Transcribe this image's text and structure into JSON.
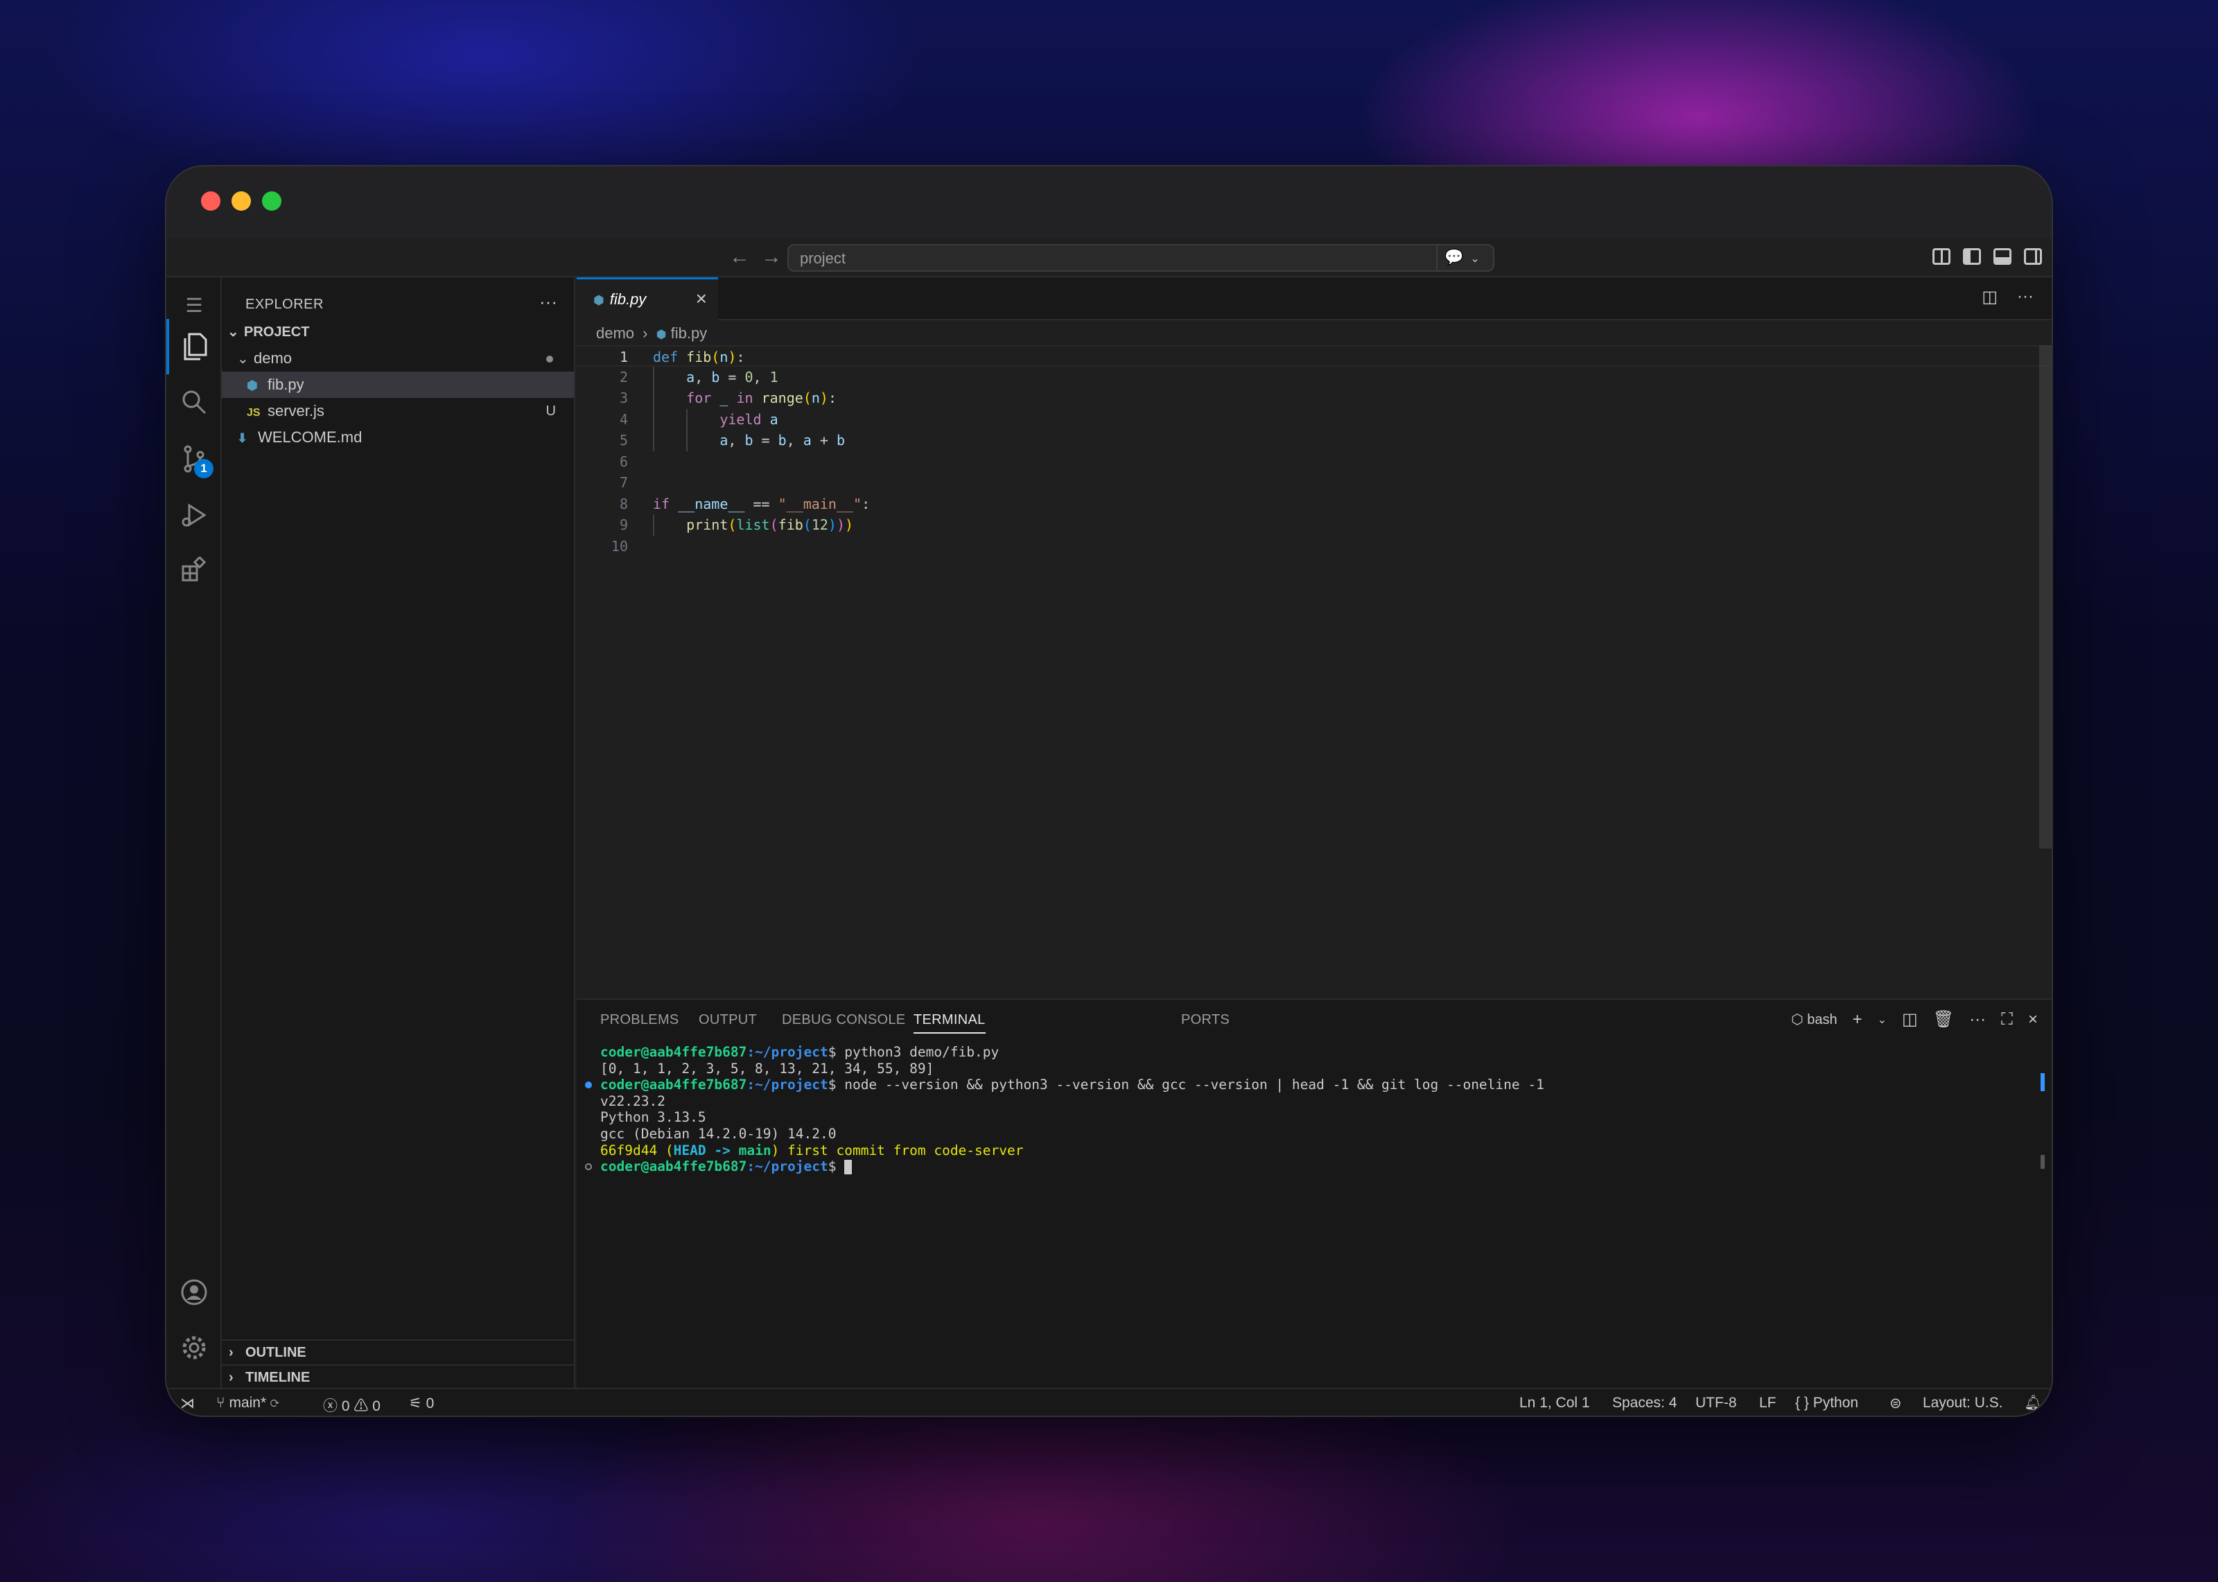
{
  "titlebar": {
    "search_text": "project"
  },
  "activity": {
    "scm_badge": "1"
  },
  "sidebar": {
    "title": "EXPLORER",
    "root": "PROJECT",
    "tree": [
      {
        "label": "demo",
        "kind": "folder"
      },
      {
        "label": "fib.py",
        "kind": "file",
        "icon": "python-icon",
        "selected": true
      },
      {
        "label": "server.js",
        "kind": "file",
        "icon": "js-icon",
        "status": "U"
      },
      {
        "label": "WELCOME.md",
        "kind": "file",
        "icon": "markdown-icon"
      }
    ],
    "js_icon_text": "JS",
    "sections": [
      "OUTLINE",
      "TIMELINE"
    ]
  },
  "editor": {
    "tab_label": "fib.py",
    "breadcrumb": [
      "demo",
      "fib.py"
    ],
    "line_numbers": [
      "1",
      "2",
      "3",
      "4",
      "5",
      "6",
      "7",
      "8",
      "9",
      "10"
    ]
  },
  "panel": {
    "tabs": [
      "PROBLEMS",
      "OUTPUT",
      "DEBUG CONSOLE",
      "TERMINAL",
      "PORTS"
    ],
    "active_tab": "TERMINAL",
    "shell_label": "bash",
    "terminal": {
      "prompt_user": "coder@aab4ffe7b687",
      "prompt_path": ":~/project",
      "cmd1": "$ python3 demo/fib.py",
      "out1": "[0, 1, 1, 2, 3, 5, 8, 13, 21, 34, 55, 89]",
      "cmd2": "$ node --version && python3 --version && gcc --version | head -1 && git log --oneline -1",
      "out2": "v22.23.2",
      "out3": "Python 3.13.5",
      "out4": "gcc (Debian 14.2.0-19) 14.2.0",
      "git_hash": "66f9d44",
      "git_open": " (",
      "git_head": "HEAD -> ",
      "git_main": "main",
      "git_rest": ") first commit from code-server",
      "prompt_end": "$ "
    }
  },
  "statusbar": {
    "branch": "main*",
    "errors": "0",
    "warnings": "0",
    "ports": "0",
    "position": "Ln 1, Col 1",
    "spaces": "Spaces: 4",
    "encoding": "UTF-8",
    "eol": "LF",
    "language": "Python",
    "layout": "Layout: U.S."
  },
  "colors": {
    "accent": "#0078d4",
    "background": "#1f1f1f"
  }
}
